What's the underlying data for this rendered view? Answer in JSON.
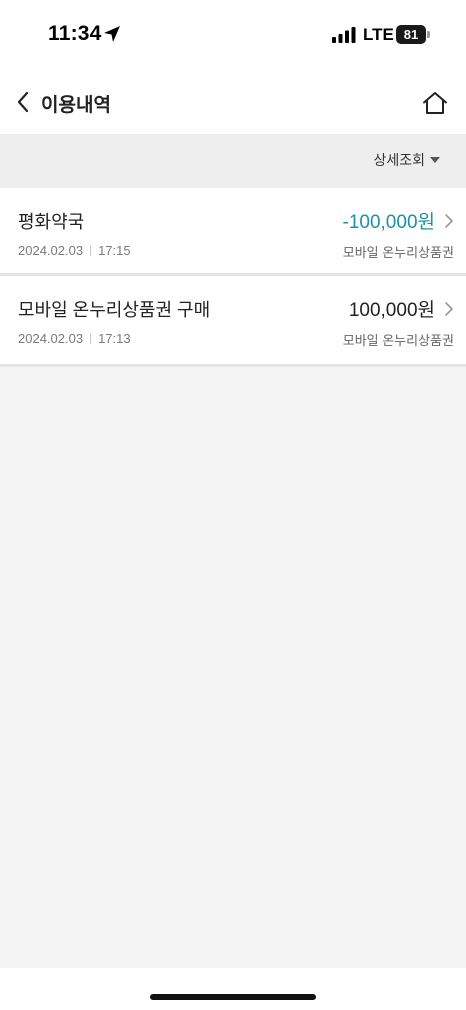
{
  "status_bar": {
    "time": "11:34",
    "network": "LTE",
    "battery": "81",
    "icons": [
      "location-arrow-icon",
      "signal-icon",
      "battery-icon"
    ]
  },
  "header": {
    "title": "이용내역",
    "back_icon": "chevron-left-icon",
    "home_icon": "home-icon"
  },
  "filter": {
    "label": "상세조회",
    "icon": "caret-down-icon"
  },
  "colors": {
    "negative_amount": "#1b91a6",
    "background": "#f3f3f3"
  },
  "transactions": [
    {
      "name": "평화약국",
      "date": "2024.02.03",
      "time": "17:15",
      "amount": "-100,000원",
      "type": "모바일 온누리상품권"
    },
    {
      "name": "모바일 온누리상품권 구매",
      "date": "2024.02.03",
      "time": "17:13",
      "amount": "100,000원",
      "type": "모바일 온누리상품권"
    }
  ]
}
